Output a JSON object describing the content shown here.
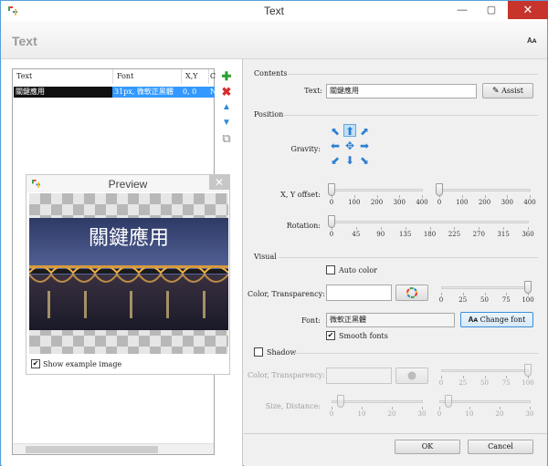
{
  "window": {
    "title": "Text",
    "close_label": "✕",
    "minimize_label": "—",
    "maximize_label": "▢"
  },
  "header": {
    "title": "Text",
    "font_size_label": "Aᴀ"
  },
  "list": {
    "columns": [
      "Text",
      "Font",
      "X,Y",
      "C"
    ],
    "rows": [
      {
        "text": "關鍵應用",
        "font": "31px, 微軟正黑體",
        "xy": "0, 0",
        "c": "N"
      }
    ]
  },
  "toolbar": {
    "add": "✚",
    "delete": "✖",
    "up": "▲",
    "down": "▼",
    "copy": "⧉"
  },
  "preview": {
    "title": "Preview",
    "close": "✕",
    "sample_text": "關鍵應用",
    "show_example_label": "Show example image",
    "show_example_checked": true
  },
  "contents": {
    "section": "Contents",
    "text_label": "Text:",
    "text_value": "關鍵應用",
    "assist_label": "Assist"
  },
  "position": {
    "section": "Position",
    "gravity_label": "Gravity:",
    "gravity_selected": "top-center",
    "xy_label": "X, Y offset:",
    "x_ticks": [
      "0",
      "100",
      "200",
      "300",
      "400"
    ],
    "y_ticks": [
      "0",
      "100",
      "200",
      "300",
      "400"
    ],
    "x_value": 0,
    "y_value": 0,
    "rotation_label": "Rotation:",
    "rotation_ticks": [
      "0",
      "45",
      "90",
      "135",
      "180",
      "225",
      "270",
      "315",
      "360"
    ],
    "rotation_value": 0
  },
  "visual": {
    "section": "Visual",
    "auto_color_label": "Auto color",
    "auto_color_checked": false,
    "color_label": "Color, Transparency:",
    "color_value": "#ffffff",
    "transparency_ticks": [
      "0",
      "25",
      "50",
      "75",
      "100"
    ],
    "transparency_value": 100,
    "font_label": "Font:",
    "font_value": "微軟正黑體",
    "change_font_label": "Change font",
    "change_font_icon": "Aᴀ",
    "smooth_label": "Smooth fonts",
    "smooth_checked": true
  },
  "shadow": {
    "label": "Shadow",
    "checked": false,
    "color_label": "Color, Transparency:",
    "transparency_ticks": [
      "0",
      "25",
      "50",
      "75",
      "100"
    ],
    "transparency_value": 100,
    "size_label": "Size, Distance:",
    "size_ticks": [
      "0",
      "10",
      "20",
      "30"
    ],
    "size_value": 3,
    "distance_ticks": [
      "0",
      "10",
      "20",
      "30"
    ],
    "distance_value": 3
  },
  "footer": {
    "ok": "OK",
    "cancel": "Cancel"
  }
}
